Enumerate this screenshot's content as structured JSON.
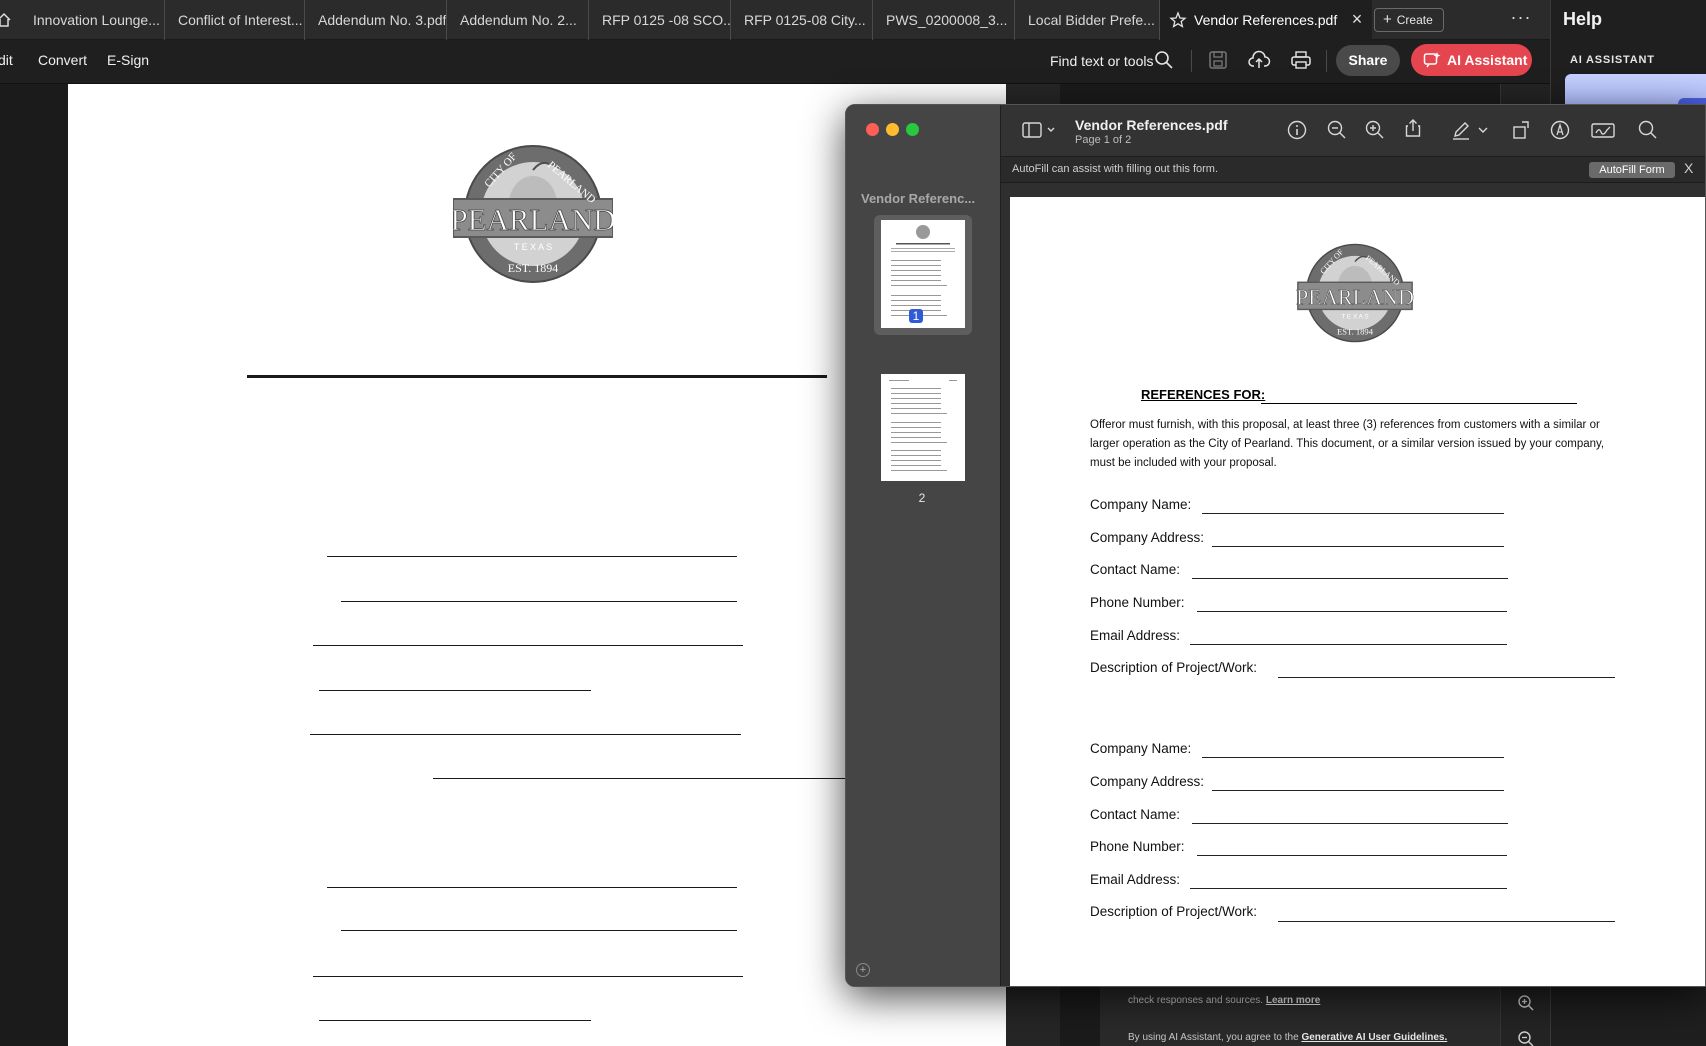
{
  "tabs": [
    {
      "label": "Innovation Lounge..."
    },
    {
      "label": "Conflict of Interest..."
    },
    {
      "label": "Addendum No. 3.pdf"
    },
    {
      "label": "Addendum No. 2..."
    },
    {
      "label": "RFP 0125 -08 SCO..."
    },
    {
      "label": "RFP 0125-08  City..."
    },
    {
      "label": "PWS_0200008_3..."
    },
    {
      "label": "Local Bidder Prefe..."
    },
    {
      "label": "Vendor References.pdf"
    }
  ],
  "tabbar": {
    "create_label": "Create",
    "more_label": "···",
    "close_label": "×"
  },
  "help": {
    "label": "Help"
  },
  "toolbar": {
    "menus": [
      "dit",
      "Convert",
      "E-Sign"
    ],
    "find_label": "Find text or tools",
    "share_label": "Share",
    "ai_label": "AI Assistant"
  },
  "ai_panel": {
    "heading": "AI ASSISTANT",
    "disclaimer_1": "check responses and sources.",
    "learn_more": "Learn more",
    "disclaimer_2": "By using AI Assistant, you agree to the",
    "guidelines_link": "Generative AI User Guidelines."
  },
  "seal": {
    "top_left_text": "CITY OF",
    "top_right_text": "PEARLAND",
    "main_text": "PEARLAND",
    "state_text": "T E X A S",
    "est_text": "EST. 1894"
  },
  "preview": {
    "sidebar_title": "Vendor Referenc...",
    "thumbnails": [
      {
        "number": "1"
      },
      {
        "number": "2"
      }
    ],
    "title": "Vendor References.pdf",
    "subtitle": "Page 1 of 2",
    "autofill_message": "AutoFill can assist with filling out this form.",
    "autofill_button": "AutoFill Form",
    "autofill_close": "X",
    "add_label": "+"
  },
  "form": {
    "heading": "REFERENCES FOR:",
    "intro": "Offeror must furnish, with this proposal, at least three (3) references from customers with a similar or  larger operation as the City of Pearland.  This document, or a similar version issued by your  company, must be included with your proposal.",
    "references": [
      {
        "company_name": "Company Name:",
        "company_address": "Company Address:",
        "contact_name": "Contact Name:",
        "phone_number": "Phone Number:",
        "email_address": "Email Address:",
        "description": "Description of Project/Work:"
      },
      {
        "company_name": "Company Name:",
        "company_address": "Company Address:",
        "contact_name": "Contact Name:",
        "phone_number": "Phone Number:",
        "email_address": "Email Address:",
        "description": "Description of Project/Work:"
      }
    ]
  },
  "colors": {
    "accent_ai": "#e5454f",
    "selection_blue": "#2f5bd6",
    "traffic_red": "#ff5f57",
    "traffic_yellow": "#febc2e",
    "traffic_green": "#28c840"
  }
}
